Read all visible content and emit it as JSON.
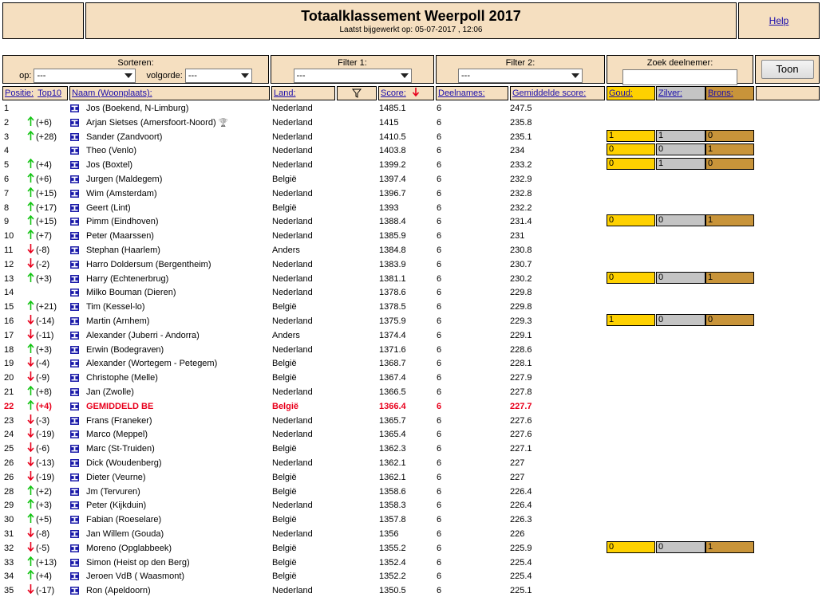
{
  "header": {
    "title": "Totaalklassement Weerpoll 2017",
    "subtitle": "Laatst bijgewerkt op: 05-07-2017 , 12:06",
    "help": "Help"
  },
  "controls": {
    "sort_title": "Sorteren:",
    "op_label": "op:",
    "op_value": "---",
    "volgorde_label": "volgorde:",
    "volgorde_value": "---",
    "filter1_title": "Filter 1:",
    "filter1_value": "---",
    "filter2_title": "Filter 2:",
    "filter2_value": "---",
    "search_title": "Zoek deelnemer:",
    "search_value": "",
    "button": "Toon"
  },
  "columns": {
    "positie": "Positie:",
    "top10": "Top10",
    "naam": "Naam (Woonplaats):",
    "land": "Land:",
    "score": "Score:",
    "deelnames": "Deelnames:",
    "gemiddelde": "Gemiddelde score:",
    "goud": "Goud:",
    "zilver": "Zilver:",
    "brons": "Brons:"
  },
  "icons": {
    "filter": "filter-icon",
    "sort": "sort-down-arrow-icon",
    "flag": "flag-icon",
    "trophy": "trophy-icon"
  },
  "colors": {
    "panel": "#f5dfc0",
    "gold": "#fed100",
    "silver": "#c4c4c4",
    "bronze": "#c8943a",
    "up": "#12c412",
    "down": "#e8001c",
    "highlight": "#e8001c"
  },
  "rows": [
    {
      "pos": "1",
      "dir": "",
      "change": "",
      "name": "Jos (Boekend, N-Limburg)",
      "land": "Nederland",
      "score": "1485.1",
      "deel": "6",
      "gem": "247.5"
    },
    {
      "pos": "2",
      "dir": "up",
      "change": "(+6)",
      "name": "Arjan Sietses (Amersfoort-Noord)",
      "trophy": true,
      "land": "Nederland",
      "score": "1415",
      "deel": "6",
      "gem": "235.8"
    },
    {
      "pos": "3",
      "dir": "up",
      "change": "(+28)",
      "name": "Sander (Zandvoort)",
      "land": "Nederland",
      "score": "1410.5",
      "deel": "6",
      "gem": "235.1",
      "medals": [
        "1",
        "1",
        "0"
      ]
    },
    {
      "pos": "4",
      "dir": "",
      "change": "",
      "name": "Theo (Venlo)",
      "land": "Nederland",
      "score": "1403.8",
      "deel": "6",
      "gem": "234",
      "medals": [
        "0",
        "0",
        "1"
      ]
    },
    {
      "pos": "5",
      "dir": "up",
      "change": "(+4)",
      "name": "Jos (Boxtel)",
      "land": "Nederland",
      "score": "1399.2",
      "deel": "6",
      "gem": "233.2",
      "medals": [
        "0",
        "1",
        "0"
      ]
    },
    {
      "pos": "6",
      "dir": "up",
      "change": "(+6)",
      "name": "Jurgen (Maldegem)",
      "land": "België",
      "score": "1397.4",
      "deel": "6",
      "gem": "232.9"
    },
    {
      "pos": "7",
      "dir": "up",
      "change": "(+15)",
      "name": "Wim (Amsterdam)",
      "land": "Nederland",
      "score": "1396.7",
      "deel": "6",
      "gem": "232.8"
    },
    {
      "pos": "8",
      "dir": "up",
      "change": "(+17)",
      "name": "Geert (Lint)",
      "land": "België",
      "score": "1393",
      "deel": "6",
      "gem": "232.2"
    },
    {
      "pos": "9",
      "dir": "up",
      "change": "(+15)",
      "name": "Pimm (Eindhoven)",
      "land": "Nederland",
      "score": "1388.4",
      "deel": "6",
      "gem": "231.4",
      "medals": [
        "0",
        "0",
        "1"
      ]
    },
    {
      "pos": "10",
      "dir": "up",
      "change": "(+7)",
      "name": "Peter (Maarssen)",
      "land": "Nederland",
      "score": "1385.9",
      "deel": "6",
      "gem": "231"
    },
    {
      "pos": "11",
      "dir": "dn",
      "change": "(-8)",
      "name": "Stephan (Haarlem)",
      "land": "Anders",
      "score": "1384.8",
      "deel": "6",
      "gem": "230.8"
    },
    {
      "pos": "12",
      "dir": "dn",
      "change": "(-2)",
      "name": "Harro Doldersum (Bergentheim)",
      "land": "Nederland",
      "score": "1383.9",
      "deel": "6",
      "gem": "230.7"
    },
    {
      "pos": "13",
      "dir": "up",
      "change": "(+3)",
      "name": "Harry (Echtenerbrug)",
      "land": "Nederland",
      "score": "1381.1",
      "deel": "6",
      "gem": "230.2",
      "medals": [
        "0",
        "0",
        "1"
      ]
    },
    {
      "pos": "14",
      "dir": "",
      "change": "",
      "name": "Milko Bouman (Dieren)",
      "land": "Nederland",
      "score": "1378.6",
      "deel": "6",
      "gem": "229.8"
    },
    {
      "pos": "15",
      "dir": "up",
      "change": "(+21)",
      "name": "Tim (Kessel-lo)",
      "land": "België",
      "score": "1378.5",
      "deel": "6",
      "gem": "229.8"
    },
    {
      "pos": "16",
      "dir": "dn",
      "change": "(-14)",
      "name": "Martin (Arnhem)",
      "land": "Nederland",
      "score": "1375.9",
      "deel": "6",
      "gem": "229.3",
      "medals": [
        "1",
        "0",
        "0"
      ]
    },
    {
      "pos": "17",
      "dir": "dn",
      "change": "(-11)",
      "name": "Alexander (Juberri - Andorra)",
      "land": "Anders",
      "score": "1374.4",
      "deel": "6",
      "gem": "229.1"
    },
    {
      "pos": "18",
      "dir": "up",
      "change": "(+3)",
      "name": "Erwin (Bodegraven)",
      "land": "Nederland",
      "score": "1371.6",
      "deel": "6",
      "gem": "228.6"
    },
    {
      "pos": "19",
      "dir": "dn",
      "change": "(-4)",
      "name": "Alexander (Wortegem - Petegem)",
      "land": "België",
      "score": "1368.7",
      "deel": "6",
      "gem": "228.1"
    },
    {
      "pos": "20",
      "dir": "dn",
      "change": "(-9)",
      "name": "Christophe (Melle)",
      "land": "België",
      "score": "1367.4",
      "deel": "6",
      "gem": "227.9"
    },
    {
      "pos": "21",
      "dir": "up",
      "change": "(+8)",
      "name": "Jan (Zwolle)",
      "land": "Nederland",
      "score": "1366.5",
      "deel": "6",
      "gem": "227.8"
    },
    {
      "pos": "22",
      "dir": "up",
      "change": "(+4)",
      "name": "GEMIDDELD BE",
      "land": "België",
      "score": "1366.4",
      "deel": "6",
      "gem": "227.7",
      "highlight": true
    },
    {
      "pos": "23",
      "dir": "dn",
      "change": "(-3)",
      "name": "Frans (Franeker)",
      "land": "Nederland",
      "score": "1365.7",
      "deel": "6",
      "gem": "227.6"
    },
    {
      "pos": "24",
      "dir": "dn",
      "change": "(-19)",
      "name": "Marco (Meppel)",
      "land": "Nederland",
      "score": "1365.4",
      "deel": "6",
      "gem": "227.6"
    },
    {
      "pos": "25",
      "dir": "dn",
      "change": "(-6)",
      "name": "Marc (St-Truiden)",
      "land": "België",
      "score": "1362.3",
      "deel": "6",
      "gem": "227.1"
    },
    {
      "pos": "26",
      "dir": "dn",
      "change": "(-13)",
      "name": "Dick (Woudenberg)",
      "land": "Nederland",
      "score": "1362.1",
      "deel": "6",
      "gem": "227"
    },
    {
      "pos": "26",
      "dir": "dn",
      "change": "(-19)",
      "name": "Dieter (Veurne)",
      "land": "België",
      "score": "1362.1",
      "deel": "6",
      "gem": "227"
    },
    {
      "pos": "28",
      "dir": "up",
      "change": "(+2)",
      "name": "Jm (Tervuren)",
      "land": "België",
      "score": "1358.6",
      "deel": "6",
      "gem": "226.4"
    },
    {
      "pos": "29",
      "dir": "up",
      "change": "(+3)",
      "name": "Peter (Kijkduin)",
      "land": "Nederland",
      "score": "1358.3",
      "deel": "6",
      "gem": "226.4"
    },
    {
      "pos": "30",
      "dir": "up",
      "change": "(+5)",
      "name": "Fabian (Roeselare)",
      "land": "België",
      "score": "1357.8",
      "deel": "6",
      "gem": "226.3"
    },
    {
      "pos": "31",
      "dir": "dn",
      "change": "(-8)",
      "name": "Jan Willem (Gouda)",
      "land": "Nederland",
      "score": "1356",
      "deel": "6",
      "gem": "226"
    },
    {
      "pos": "32",
      "dir": "dn",
      "change": "(-5)",
      "name": "Moreno (Opglabbeek)",
      "land": "België",
      "score": "1355.2",
      "deel": "6",
      "gem": "225.9",
      "medals": [
        "0",
        "0",
        "1"
      ]
    },
    {
      "pos": "33",
      "dir": "up",
      "change": "(+13)",
      "name": "Simon (Heist op den Berg)",
      "land": "België",
      "score": "1352.4",
      "deel": "6",
      "gem": "225.4"
    },
    {
      "pos": "34",
      "dir": "up",
      "change": "(+4)",
      "name": "Jeroen VdB ( Waasmont)",
      "land": "België",
      "score": "1352.2",
      "deel": "6",
      "gem": "225.4"
    },
    {
      "pos": "35",
      "dir": "dn",
      "change": "(-17)",
      "name": "Ron (Apeldoorn)",
      "land": "Nederland",
      "score": "1350.5",
      "deel": "6",
      "gem": "225.1"
    }
  ]
}
